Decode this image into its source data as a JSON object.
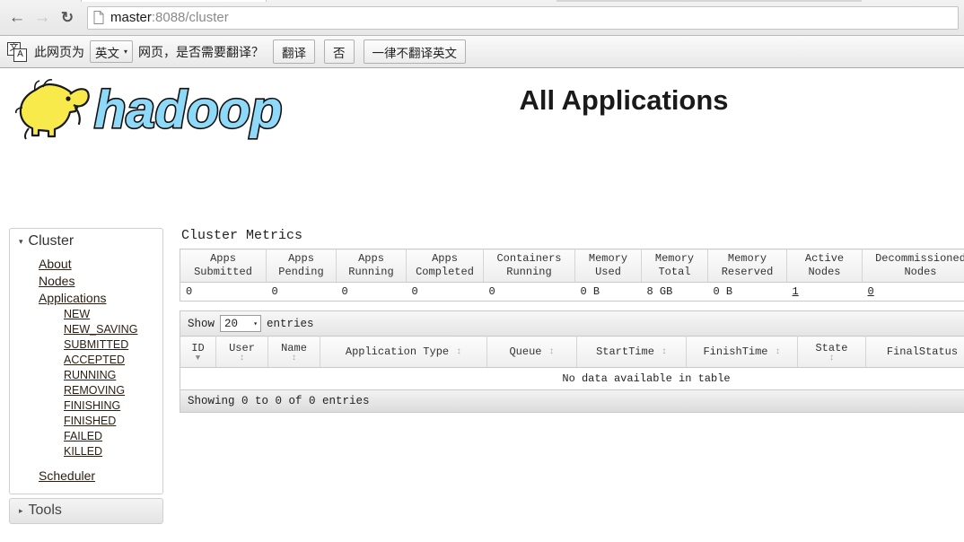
{
  "browser": {
    "back_icon": "back-arrow-icon",
    "forward_icon": "forward-arrow-icon",
    "reload_icon": "reload-icon",
    "url_host": "master",
    "url_path": ":8088/cluster",
    "page_icon": "document-icon"
  },
  "translate_bar": {
    "icon": "translate-icon",
    "icon_glyph_1": "文",
    "icon_glyph_2": "A",
    "text_before": "此网页为",
    "lang_value": "英文",
    "caret": "▾",
    "text_after": "网页，是否需要翻译？",
    "translate_label": "翻译",
    "no_label": "否",
    "never_label": "一律不翻译英文"
  },
  "header": {
    "title": "All Applications",
    "logo_text": "hadoop"
  },
  "sidebar": {
    "cluster": {
      "label": "Cluster",
      "expanded_marker": "▾",
      "links": [
        "About",
        "Nodes",
        "Applications"
      ],
      "states": [
        "NEW",
        "NEW_SAVING",
        "SUBMITTED",
        "ACCEPTED",
        "RUNNING",
        "REMOVING",
        "FINISHING",
        "FINISHED",
        "FAILED",
        "KILLED"
      ],
      "scheduler": "Scheduler"
    },
    "tools": {
      "label": "Tools",
      "collapsed_marker": "▸"
    }
  },
  "main": {
    "metrics_title": "Cluster Metrics",
    "metrics": {
      "headers": [
        [
          "Apps",
          "Submitted"
        ],
        [
          "Apps",
          "Pending"
        ],
        [
          "Apps",
          "Running"
        ],
        [
          "Apps",
          "Completed"
        ],
        [
          "Containers",
          "Running"
        ],
        [
          "Memory",
          "Used"
        ],
        [
          "Memory",
          "Total"
        ],
        [
          "Memory",
          "Reserved"
        ],
        [
          "Active",
          "Nodes"
        ],
        [
          "Decommissioned",
          "Nodes"
        ]
      ],
      "values": [
        "0",
        "0",
        "0",
        "0",
        "0",
        "0 B",
        "8 GB",
        "0 B",
        "1",
        "0"
      ],
      "link_columns": [
        8,
        9
      ]
    },
    "datatable": {
      "show_label": "Show",
      "length_value": "20",
      "length_caret": "▾",
      "entries_label": "entries",
      "columns": [
        {
          "label": "ID",
          "sort": "desc"
        },
        {
          "label": "User",
          "sort": "none"
        },
        {
          "label": "Name",
          "sort": "none"
        },
        {
          "label": "Application Type",
          "sort": "none"
        },
        {
          "label": "Queue",
          "sort": "none"
        },
        {
          "label": "StartTime",
          "sort": "none"
        },
        {
          "label": "FinishTime",
          "sort": "none"
        },
        {
          "label": "State",
          "sort": "none"
        },
        {
          "label": "FinalStatus",
          "sort": "none"
        }
      ],
      "empty_message": "No data available in table",
      "info": "Showing 0 to 0 of 0 entries"
    }
  },
  "colors": {
    "logo_blue": "#8ed8f8",
    "logo_yellow": "#f5e642",
    "link": "#2b1e12",
    "border": "#c9c9c9"
  }
}
